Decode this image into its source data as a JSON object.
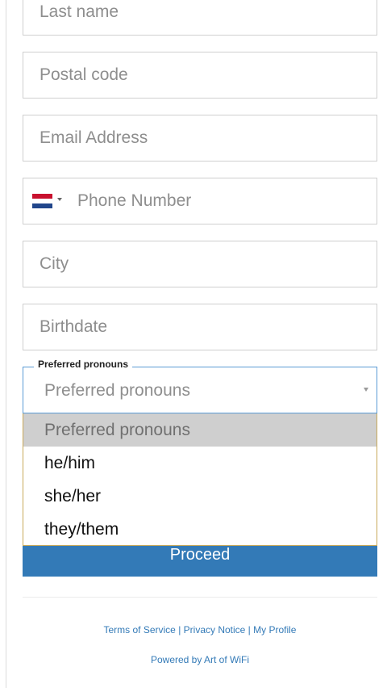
{
  "form": {
    "fields": [
      {
        "placeholder": "Last name"
      },
      {
        "placeholder": "Postal code"
      },
      {
        "placeholder": "Email Address"
      },
      {
        "placeholder": "Phone Number"
      },
      {
        "placeholder": "City"
      },
      {
        "placeholder": "Birthdate"
      }
    ],
    "phone_flag_icon": "netherlands-flag-icon",
    "pronouns": {
      "legend": "Preferred pronouns",
      "selected": "Preferred pronouns",
      "options": [
        "Preferred pronouns",
        "he/him",
        "she/her",
        "they/them"
      ]
    },
    "proceed_label": "Proceed"
  },
  "footer": {
    "terms": "Terms of Service",
    "privacy": "Privacy Notice",
    "profile": "My Profile",
    "separator": " | ",
    "powered_by": "Powered by Art of WiFi"
  },
  "colors": {
    "accent": "#337ab7",
    "focus_border": "#5b9bd5",
    "option_highlight": "#cfcfcf"
  }
}
